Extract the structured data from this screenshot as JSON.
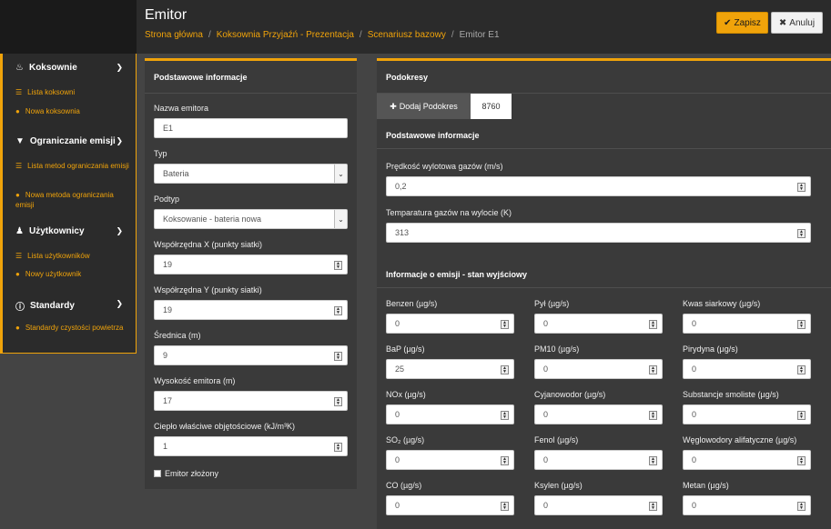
{
  "header": {
    "title": "Emitor",
    "breadcrumb": [
      "Strona główna",
      "Koksownia Przyjaźń - Prezentacja",
      "Scenariusz bazowy",
      "Emitor E1"
    ],
    "save_label": "Zapisz",
    "cancel_label": "Anuluj"
  },
  "sidebar": {
    "sections": [
      {
        "label": "Koksownie",
        "items": [
          "Lista koksowni",
          "Nowa koksownia"
        ]
      },
      {
        "label": "Ograniczanie emisji",
        "items": [
          "Lista metod ograniczania emisji",
          "Nowa metoda ograniczania emisji"
        ]
      },
      {
        "label": "Użytkownicy",
        "items": [
          "Lista użytkowników",
          "Nowy użytkownik"
        ]
      },
      {
        "label": "Standardy",
        "items": [
          "Standardy czystości powietrza"
        ]
      }
    ]
  },
  "basic": {
    "heading": "Podstawowe informacje",
    "fields": [
      {
        "label": "Nazwa emitora",
        "value": "E1"
      },
      {
        "label": "Typ",
        "value": "Bateria"
      },
      {
        "label": "Podtyp",
        "value": "Koksowanie - bateria nowa"
      },
      {
        "label": "Współrzędna X (punkty siatki)",
        "value": "19"
      },
      {
        "label": "Współrzędna Y (punkty siatki)",
        "value": "19"
      },
      {
        "label": "Średnica (m)",
        "value": "9"
      },
      {
        "label": "Wysokość emitora (m)",
        "value": "17"
      },
      {
        "label": "Ciepło właściwe objętościowe (kJ/m³K)",
        "value": "1"
      }
    ],
    "checkbox_label": "Emitor złożony"
  },
  "podokresy": {
    "heading": "Podokresy",
    "add_tab": "Dodaj Podokres",
    "active_tab": "8760",
    "basic_heading": "Podstawowe informacje",
    "velocity_label": "Prędkość wylotowa gazów (m/s)",
    "velocity_value": "0,2",
    "temp_label": "Temparatura gazów na wylocie (K)",
    "temp_value": "313",
    "emission_heading": "Informacje o emisji - stan wyjściowy",
    "emissions": [
      {
        "label": "Benzen (µg/s)",
        "value": "0"
      },
      {
        "label": "Pył (µg/s)",
        "value": "0"
      },
      {
        "label": "Kwas siarkowy (µg/s)",
        "value": "0"
      },
      {
        "label": "BaP (µg/s)",
        "value": "25"
      },
      {
        "label": "PM10 (µg/s)",
        "value": "0"
      },
      {
        "label": "Pirydyna (µg/s)",
        "value": "0"
      },
      {
        "label": "NOx (µg/s)",
        "value": "0"
      },
      {
        "label": "Cyjanowodor (µg/s)",
        "value": "0"
      },
      {
        "label": "Substancje smoliste (µg/s)",
        "value": "0"
      },
      {
        "label": "SO₂ (µg/s)",
        "value": "0"
      },
      {
        "label": "Fenol (µg/s)",
        "value": "0"
      },
      {
        "label": "Węglowodory alifatyczne (µg/s)",
        "value": "0"
      },
      {
        "label": "CO (µg/s)",
        "value": "0"
      },
      {
        "label": "Ksylen (µg/s)",
        "value": "0"
      },
      {
        "label": "Metan (µg/s)",
        "value": "0"
      }
    ]
  }
}
